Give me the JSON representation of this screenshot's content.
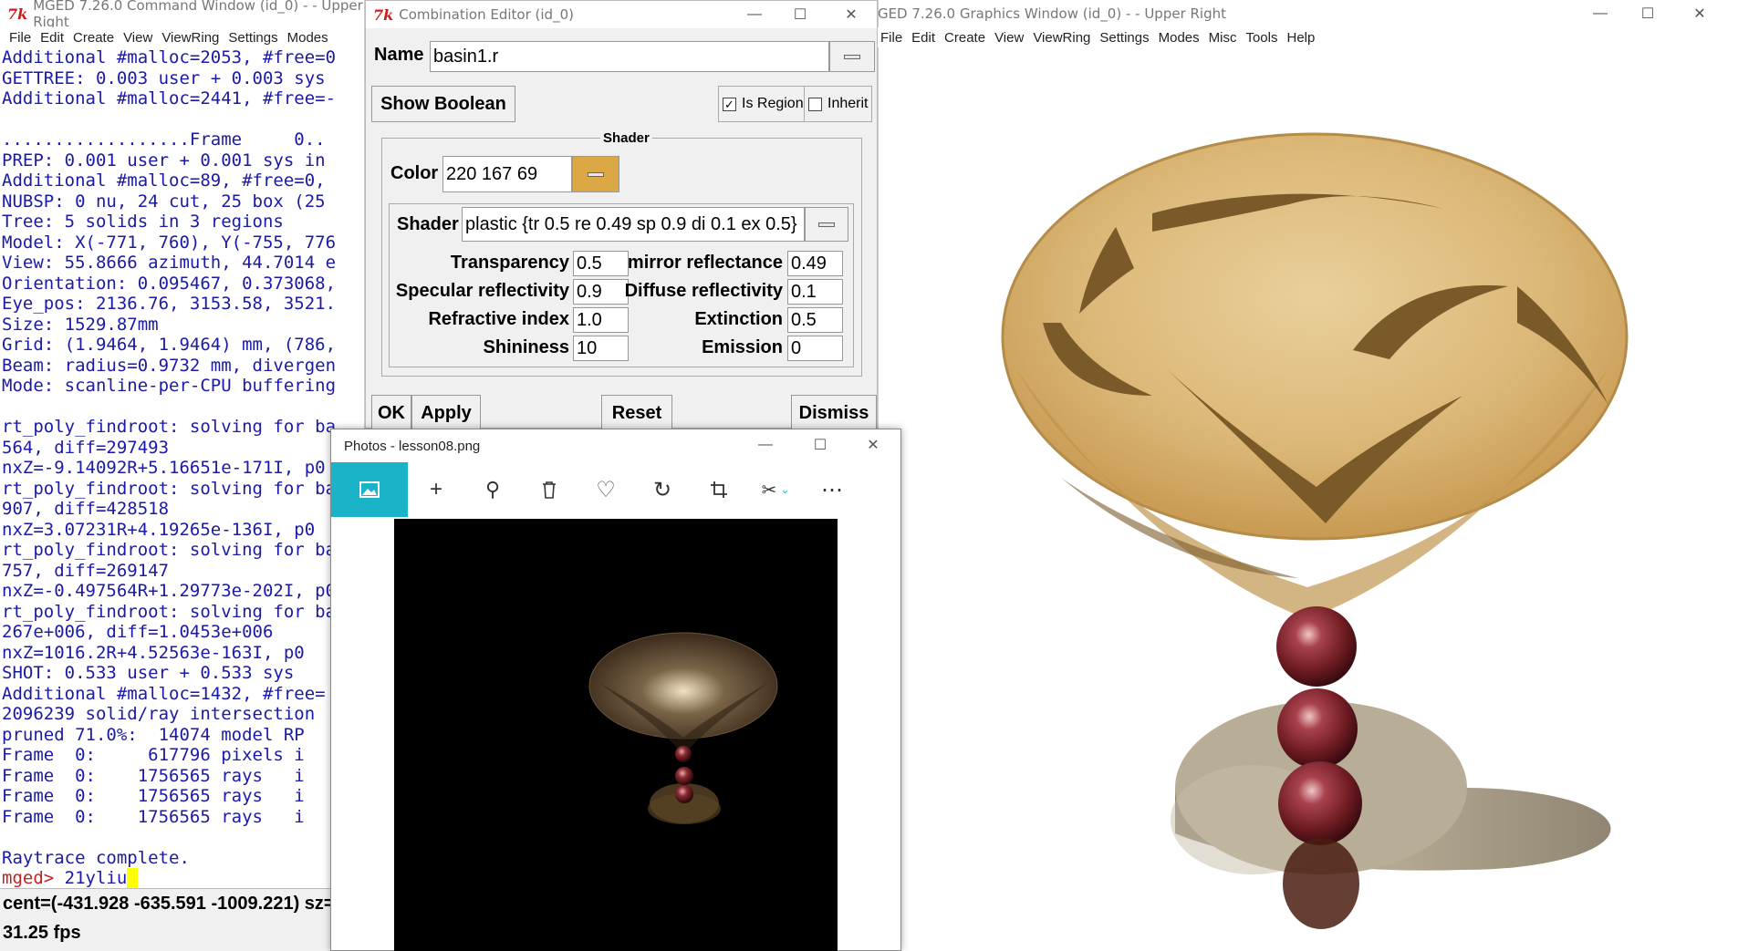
{
  "command_window": {
    "title": "MGED 7.26.0 Command Window (id_0) -  - Upper Right",
    "menu": [
      "File",
      "Edit",
      "Create",
      "View",
      "ViewRing",
      "Settings",
      "Modes"
    ],
    "log_lines": [
      "Additional #malloc=2053, #free=0",
      "GETTREE: 0.003 user + 0.003 sys",
      "Additional #malloc=2441, #free=-",
      "",
      "..................Frame     0..",
      "PREP: 0.001 user + 0.001 sys in",
      "Additional #malloc=89, #free=0,",
      "NUBSP: 0 nu, 24 cut, 25 box (25",
      "Tree: 5 solids in 3 regions",
      "Model: X(-771, 760), Y(-755, 776",
      "View: 55.8666 azimuth, 44.7014 e",
      "Orientation: 0.095467, 0.373068,",
      "Eye_pos: 2136.76, 3153.58, 3521.",
      "Size: 1529.87mm",
      "Grid: (1.9464, 1.9464) mm, (786,",
      "Beam: radius=0.9732 mm, divergen",
      "Mode: scanline-per-CPU buffering",
      "",
      "rt_poly_findroot: solving for ba",
      "564, diff=297493",
      "nxZ=-9.14092R+5.16651e-171I, p0",
      "rt_poly_findroot: solving for ba",
      "907, diff=428518",
      "nxZ=3.07231R+4.19265e-136I, p0",
      "rt_poly_findroot: solving for ba",
      "757, diff=269147",
      "nxZ=-0.497564R+1.29773e-202I, p0",
      "rt_poly_findroot: solving for ba",
      "267e+006, diff=1.0453e+006",
      "nxZ=1016.2R+4.52563e-163I, p0",
      "SHOT: 0.533 user + 0.533 sys",
      "Additional #malloc=1432, #free=",
      "2096239 solid/ray intersection",
      "pruned 71.0%:  14074 model RP",
      "Frame  0:     617796 pixels i",
      "Frame  0:    1756565 rays   i",
      "Frame  0:    1756565 rays   i",
      "Frame  0:    1756565 rays   i",
      "",
      "Raytrace complete."
    ],
    "prompt": "mged>",
    "input": "21yliu",
    "status_cent": "cent=(-431.928 -635.591 -1009.221) sz=",
    "status_fps": "31.25 fps"
  },
  "graphics_window": {
    "title": "MGED 7.26.0 Graphics Window (id_0) -  - Upper Right",
    "menu": [
      "File",
      "Edit",
      "Create",
      "View",
      "ViewRing",
      "Settings",
      "Modes",
      "Misc",
      "Tools",
      "Help"
    ]
  },
  "combination_editor": {
    "title": "Combination Editor (id_0)",
    "name_label": "Name",
    "name_value": "basin1.r",
    "show_boolean": "Show Boolean",
    "is_region_label": "Is Region",
    "is_region_checked": true,
    "inherit_label": "Inherit",
    "inherit_checked": false,
    "shader_group": "Shader",
    "color_label": "Color",
    "color_value": "220 167 69",
    "color_swatch": "#dca745",
    "shader_label": "Shader",
    "shader_value": "plastic {tr 0.5 re 0.49 sp 0.9 di 0.1 ex 0.5}",
    "fields": {
      "transparency_label": "Transparency",
      "transparency": "0.5",
      "mirror_label": "mirror reflectance",
      "mirror": "0.49",
      "specular_label": "Specular reflectivity",
      "specular": "0.9",
      "diffuse_label": "Diffuse reflectivity",
      "diffuse": "0.1",
      "refractive_label": "Refractive index",
      "refractive": "1.0",
      "extinction_label": "Extinction",
      "extinction": "0.5",
      "shininess_label": "Shininess",
      "shininess": "10",
      "emission_label": "Emission",
      "emission": "0"
    },
    "buttons": {
      "ok": "OK",
      "apply": "Apply",
      "reset": "Reset",
      "dismiss": "Dismiss"
    }
  },
  "photos_window": {
    "title": "Photos - lesson08.png",
    "accent": "#1ab3c8",
    "tools": [
      "image-icon",
      "add-icon",
      "zoom-icon",
      "delete-icon",
      "favorite-icon",
      "rotate-icon",
      "crop-icon",
      "edit-icon",
      "more-icon"
    ]
  }
}
